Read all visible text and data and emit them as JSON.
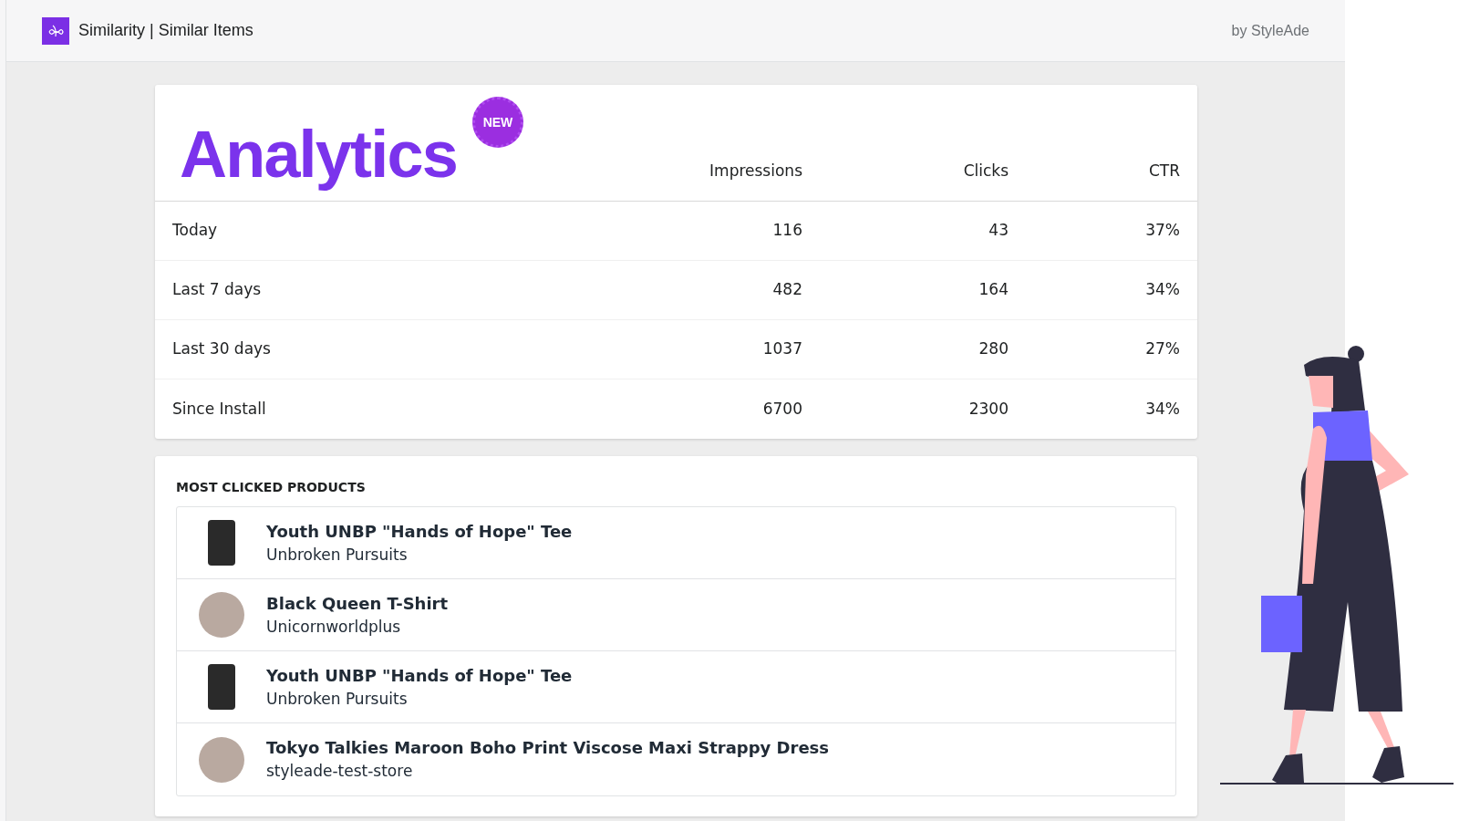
{
  "header": {
    "title": "Similarity | Similar Items",
    "byline": "by StyleAde"
  },
  "analytics": {
    "heading": "Analytics",
    "badge": "NEW",
    "columns": [
      "Impressions",
      "Clicks",
      "CTR"
    ],
    "rows": [
      {
        "period": "Today",
        "impressions": "116",
        "clicks": "43",
        "ctr": "37%"
      },
      {
        "period": "Last 7 days",
        "impressions": "482",
        "clicks": "164",
        "ctr": "34%"
      },
      {
        "period": "Last 30 days",
        "impressions": "1037",
        "clicks": "280",
        "ctr": "27%"
      },
      {
        "period": "Since Install",
        "impressions": "6700",
        "clicks": "2300",
        "ctr": "34%"
      }
    ]
  },
  "most_clicked": {
    "title": "MOST CLICKED PRODUCTS",
    "products": [
      {
        "name": "Youth UNBP \"Hands of Hope\" Tee",
        "store": "Unbroken Pursuits",
        "kind": "square"
      },
      {
        "name": "Black Queen T-Shirt",
        "store": "Unicornworldplus",
        "kind": "round"
      },
      {
        "name": "Youth UNBP \"Hands of Hope\" Tee",
        "store": "Unbroken Pursuits",
        "kind": "square"
      },
      {
        "name": "Tokyo Talkies Maroon Boho Print Viscose Maxi Strappy Dress",
        "store": "styleade-test-store",
        "kind": "round"
      }
    ]
  }
}
